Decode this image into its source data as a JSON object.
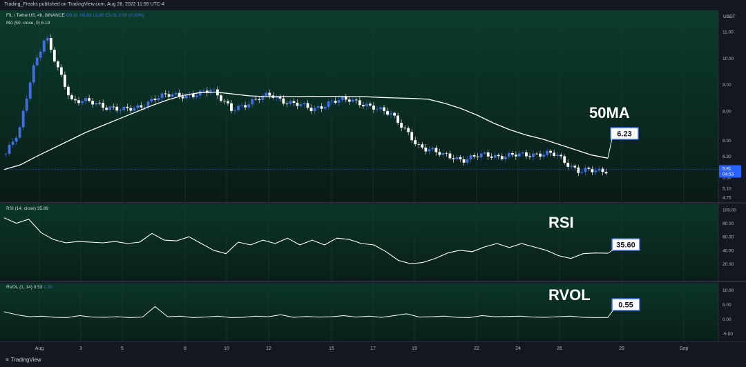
{
  "header": {
    "publisher": "Trading_Freaks published on TradingView.com, Aug 28, 2022 11:55 UTC-4"
  },
  "legends": {
    "symbol": "FIL / TetherUS, 4h, BINANCE",
    "ohlc": "O5.81  H5.83  L5.80  C5.81  0.00 (0.00%)",
    "ma": "MA (50, close, 0)",
    "ma_value": "6.19",
    "rsi": "RSI (14, close)",
    "rsi_value": "35.89",
    "rvol": "RVOL (1, 14)",
    "rvol_value": "0.53",
    "rvol_value2": "1.00"
  },
  "footer": {
    "brand": "TradingView"
  },
  "colors": {
    "background": "#131722",
    "pane_green": "#0b3b2c",
    "up_candle": "#3f6fe0",
    "down_candle": "#ffffff",
    "line": "#ffffff",
    "annotation_border": "#3f6fe0",
    "price_tag": "#2962ff"
  },
  "chart_data": [
    {
      "type": "candlestick",
      "title": "FIL / TetherUS, 4h, BINANCE",
      "price_axis_label": "USDT",
      "x_ticks": [
        "Aug",
        "3",
        "5",
        "8",
        "10",
        "12",
        "15",
        "17",
        "19",
        "22",
        "24",
        "26",
        "29",
        "Sep"
      ],
      "y_ticks": [
        "11.00",
        "10.00",
        "9.00",
        "8.00",
        "6.90",
        "6.30",
        "5.50",
        "5.10",
        "4.75"
      ],
      "ylim": [
        4.6,
        11.8
      ],
      "current_price_label": "5.81",
      "countdown_label": "04:53",
      "series": [
        {
          "name": "MA (50, close, 0)",
          "values": [
            5.8,
            5.98,
            6.3,
            6.6,
            6.9,
            7.2,
            7.45,
            7.7,
            7.95,
            8.2,
            8.42,
            8.6,
            8.7,
            8.72,
            8.65,
            8.58,
            8.55,
            8.55,
            8.55,
            8.56,
            8.56,
            8.55,
            8.55,
            8.52,
            8.5,
            8.48,
            8.45,
            8.3,
            8.1,
            7.85,
            7.55,
            7.3,
            7.1,
            6.95,
            6.75,
            6.55,
            6.35,
            6.23
          ]
        }
      ],
      "annotations": [
        {
          "text": "50MA"
        },
        {
          "text": "6.23"
        }
      ]
    },
    {
      "type": "line",
      "title": "RSI (14, close)",
      "y_ticks": [
        "100.00",
        "80.00",
        "60.00",
        "40.00",
        "20.00"
      ],
      "ylim": [
        0,
        100
      ],
      "series": [
        {
          "name": "RSI (14, close)",
          "values": [
            88,
            80,
            86,
            66,
            56,
            51,
            53,
            52,
            51,
            53,
            50,
            52,
            65,
            55,
            54,
            60,
            50,
            40,
            35,
            52,
            48,
            55,
            50,
            58,
            48,
            55,
            48,
            58,
            56,
            50,
            48,
            38,
            25,
            20,
            22,
            28,
            36,
            40,
            38,
            45,
            50,
            44,
            50,
            45,
            40,
            32,
            28,
            35,
            36,
            35.6
          ]
        }
      ],
      "annotations": [
        {
          "text": "RSI"
        },
        {
          "text": "35.60"
        }
      ]
    },
    {
      "type": "line",
      "title": "RVOL (1, 14)",
      "y_ticks": [
        "10.00",
        "5.00",
        "0.00",
        "-5.00"
      ],
      "ylim": [
        -7.5,
        12.5
      ],
      "series": [
        {
          "name": "RVOL (1, 14)",
          "values": [
            2.5,
            1.5,
            0.8,
            1.0,
            0.6,
            0.5,
            1.2,
            0.7,
            0.6,
            0.8,
            0.5,
            0.7,
            4.3,
            0.8,
            1.0,
            0.5,
            0.7,
            1.0,
            0.5,
            0.6,
            1.0,
            0.8,
            1.5,
            0.6,
            0.9,
            0.7,
            0.8,
            1.2,
            0.7,
            1.0,
            0.6,
            1.2,
            1.8,
            0.7,
            0.8,
            1.0,
            0.6,
            0.5,
            1.2,
            0.8,
            0.9,
            1.0,
            0.7,
            0.6,
            0.8,
            1.0,
            0.6,
            0.5,
            0.55
          ]
        }
      ],
      "annotations": [
        {
          "text": "RVOL"
        },
        {
          "text": "0.55"
        }
      ]
    }
  ]
}
